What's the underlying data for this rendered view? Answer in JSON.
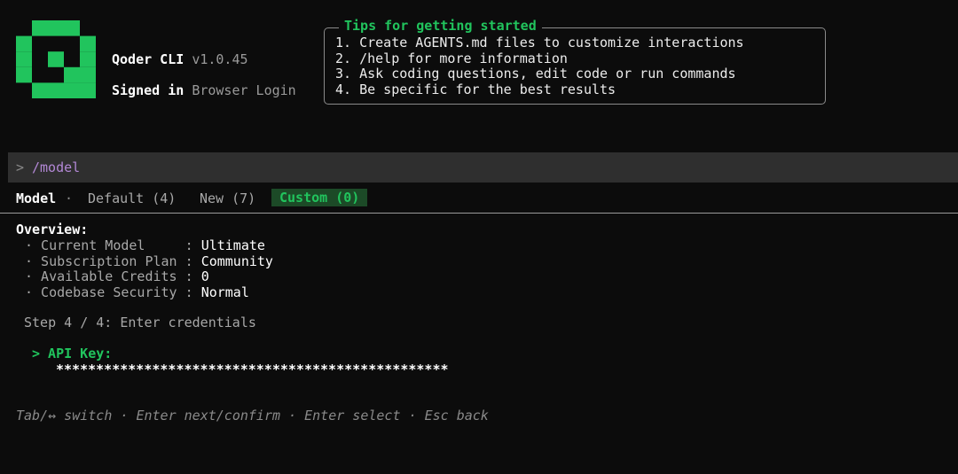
{
  "header": {
    "app_name": "Qoder CLI",
    "version": "v1.0.45",
    "signed_label": "Signed in",
    "signed_value": "Browser Login"
  },
  "tips": {
    "title": "Tips for getting started",
    "items": [
      "1. Create AGENTS.md files to customize interactions",
      "2. /help for more information",
      "3. Ask coding questions, edit code or run commands",
      "4. Be specific for the best results"
    ]
  },
  "command": {
    "prompt": ">",
    "text": "/model"
  },
  "tabs": {
    "model": "Model",
    "separator": "·",
    "default": "Default (4)",
    "new": "New (7)",
    "custom": "Custom (0)"
  },
  "overview": {
    "title": "Overview:",
    "rows": [
      {
        "label": "· Current Model     : ",
        "value": "Ultimate"
      },
      {
        "label": "· Subscription Plan : ",
        "value": "Community"
      },
      {
        "label": "· Available Credits : ",
        "value": "0"
      },
      {
        "label": "· Codebase Security : ",
        "value": "Normal"
      }
    ]
  },
  "step": "Step 4 / 4: Enter credentials",
  "api_key": {
    "label": "> API Key:",
    "masked_value": "*************************************************"
  },
  "footer": "Tab/↔ switch · Enter next/confirm · Enter select · Esc back",
  "colors": {
    "accent_green": "#21c45d",
    "command_purple": "#b388d6",
    "background": "#0c0c0c"
  }
}
